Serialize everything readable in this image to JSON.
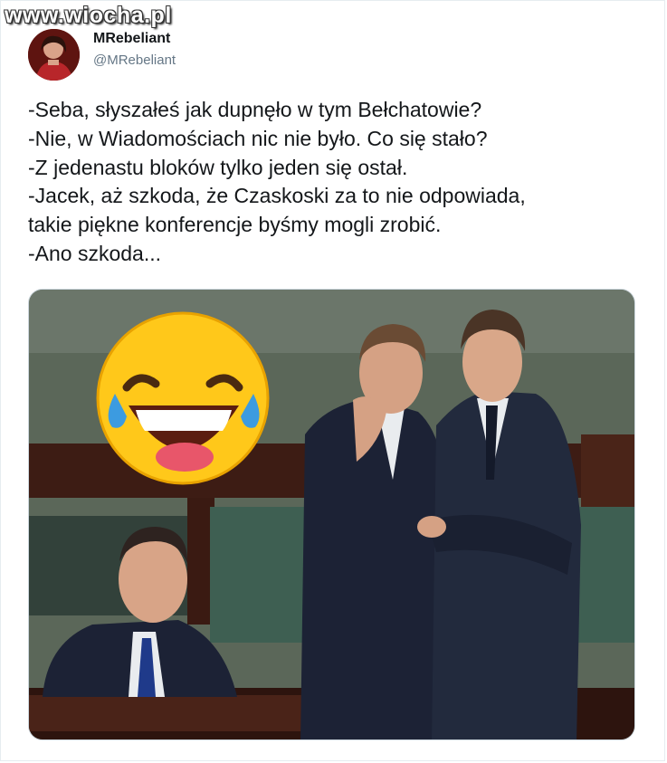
{
  "watermark": "www.wiocha.pl",
  "tweet": {
    "author_name": "MRebeliant",
    "author_handle": "@MRebeliant",
    "lines": [
      "-Seba, słyszałeś jak dupnęło w tym Bełchatowie?",
      "-Nie, w Wiadomościach nic nie było. Co się stało?",
      "-Z jedenastu bloków tylko jeden się ostał.",
      "-Jacek, aż szkoda, że Czaskoski za to nie odpowiada,",
      "takie piękne konferencje byśmy mogli zrobić.",
      "-Ano szkoda..."
    ]
  },
  "media": {
    "sticker_icon": "laughing-tears-emoji-icon",
    "colors": {
      "wall": "#5b6759",
      "bench_green": "#3e5f52",
      "wood": "#3d1c14",
      "suit": "#1c2235",
      "emoji_yellow": "#ffc81a",
      "tear_blue": "#3c9be0"
    }
  }
}
